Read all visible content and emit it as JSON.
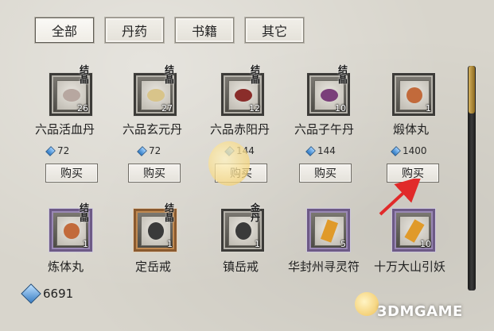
{
  "tabs": [
    {
      "label": "全部",
      "active": true
    },
    {
      "label": "丹药",
      "active": false
    },
    {
      "label": "书籍",
      "active": false
    },
    {
      "label": "其它",
      "active": false
    }
  ],
  "items": [
    {
      "name": "六品活血丹",
      "count": "26",
      "badge": "结晶",
      "price": "72",
      "buy": "购买",
      "icon": "elixir-icon",
      "color": "#b7a7a0"
    },
    {
      "name": "六品玄元丹",
      "count": "27",
      "badge": "结晶",
      "price": "72",
      "buy": "购买",
      "icon": "elixir-icon",
      "color": "#d8c48a"
    },
    {
      "name": "六品赤阳丹",
      "count": "12",
      "badge": "结晶",
      "price": "144",
      "buy": "购买",
      "icon": "elixir-icon",
      "color": "#8a2d2a"
    },
    {
      "name": "六品子午丹",
      "count": "10",
      "badge": "结晶",
      "price": "144",
      "buy": "购买",
      "icon": "elixir-icon",
      "color": "#7a3f7a"
    },
    {
      "name": "煅体丸",
      "count": "1",
      "badge": "",
      "price": "1400",
      "buy": "购买",
      "icon": "pill-icon",
      "color": "#c26a3b"
    },
    {
      "name": "炼体丸",
      "count": "1",
      "badge": "结晶",
      "price": "",
      "buy": "",
      "icon": "pill-icon",
      "color": "#c26a3b"
    },
    {
      "name": "定岳戒",
      "count": "1",
      "badge": "结晶",
      "price": "",
      "buy": "",
      "icon": "ring-icon",
      "color": "#3a3a3a"
    },
    {
      "name": "镇岳戒",
      "count": "1",
      "badge": "金丹",
      "price": "",
      "buy": "",
      "icon": "ring-icon",
      "color": "#3a3a3a"
    },
    {
      "name": "华封州寻灵符",
      "count": "5",
      "badge": "",
      "price": "",
      "buy": "",
      "icon": "talisman-icon",
      "color": "#e09a2a"
    },
    {
      "name": "十万大山引妖",
      "count": "10",
      "badge": "",
      "price": "",
      "buy": "",
      "icon": "talisman-icon",
      "color": "#e09a2a"
    }
  ],
  "currency": {
    "value": "6691"
  },
  "watermark": "3DMGAME"
}
